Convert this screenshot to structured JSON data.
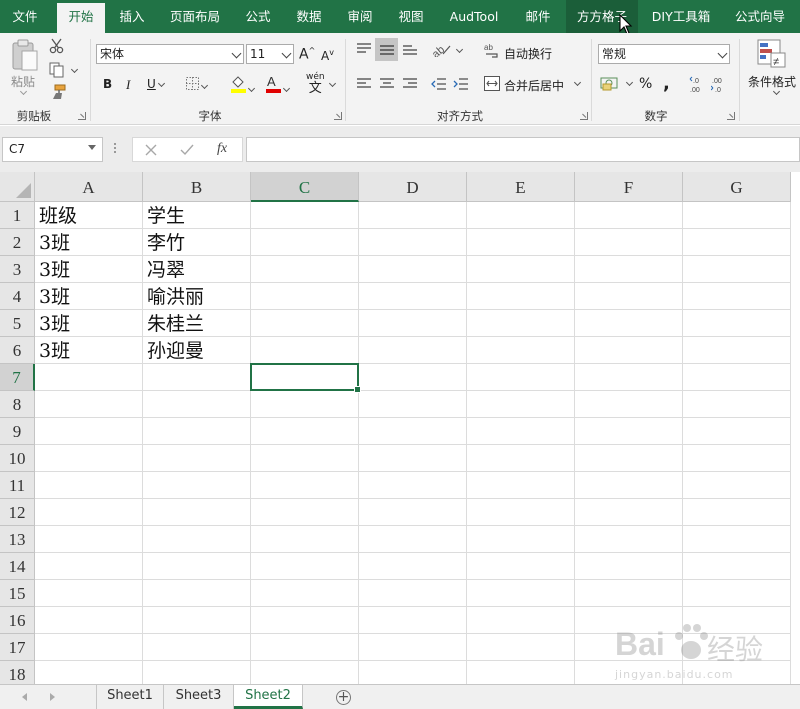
{
  "ribbon_tabs": [
    {
      "label": "文件"
    },
    {
      "label": "开始"
    },
    {
      "label": "插入"
    },
    {
      "label": "页面布局"
    },
    {
      "label": "公式"
    },
    {
      "label": "数据"
    },
    {
      "label": "审阅"
    },
    {
      "label": "视图"
    },
    {
      "label": "AudTool"
    },
    {
      "label": "邮件"
    },
    {
      "label": "方方格子"
    },
    {
      "label": "DIY工具箱"
    },
    {
      "label": "公式向导"
    }
  ],
  "active_tab": "开始",
  "clipboard": {
    "paste_label": "粘贴",
    "group_label": "剪贴板"
  },
  "font": {
    "name": "宋体",
    "size": "11",
    "group_label": "字体",
    "bold": "B",
    "italic": "I",
    "underline": "U",
    "grow": "A",
    "shrink": "A",
    "phonetic": "wén",
    "phonetic_char": "文"
  },
  "alignment": {
    "wrap_label": "自动换行",
    "merge_label": "合并后居中",
    "group_label": "对齐方式"
  },
  "number": {
    "format": "常规",
    "percent": "%",
    "comma": ",",
    "group_label": "数字"
  },
  "styles": {
    "conditional_label": "条件格式"
  },
  "formula_bar": {
    "name_box": "C7",
    "fx": "fx",
    "value": ""
  },
  "columns": [
    "A",
    "B",
    "C",
    "D",
    "E",
    "F",
    "G"
  ],
  "selected_column": "C",
  "rows": [
    "1",
    "2",
    "3",
    "4",
    "5",
    "6",
    "7",
    "8",
    "9",
    "10",
    "11",
    "12",
    "13",
    "14",
    "15",
    "16",
    "17",
    "18"
  ],
  "selected_row": "7",
  "cells": [
    [
      "班级",
      "学生"
    ],
    [
      "3班",
      "李竹"
    ],
    [
      "3班",
      "冯翠"
    ],
    [
      "3班",
      "喻洪丽"
    ],
    [
      "3班",
      "朱桂兰"
    ],
    [
      "3班",
      "孙迎曼"
    ]
  ],
  "sheets": [
    {
      "label": "Sheet1"
    },
    {
      "label": "Sheet3"
    },
    {
      "label": "Sheet2"
    }
  ],
  "active_sheet": "Sheet2",
  "watermark": {
    "text": "Bai",
    "text2": "经验",
    "url": "jingyan.baidu.com"
  },
  "colors": {
    "accent": "#217346",
    "ribbon": "#f3f3f3"
  }
}
